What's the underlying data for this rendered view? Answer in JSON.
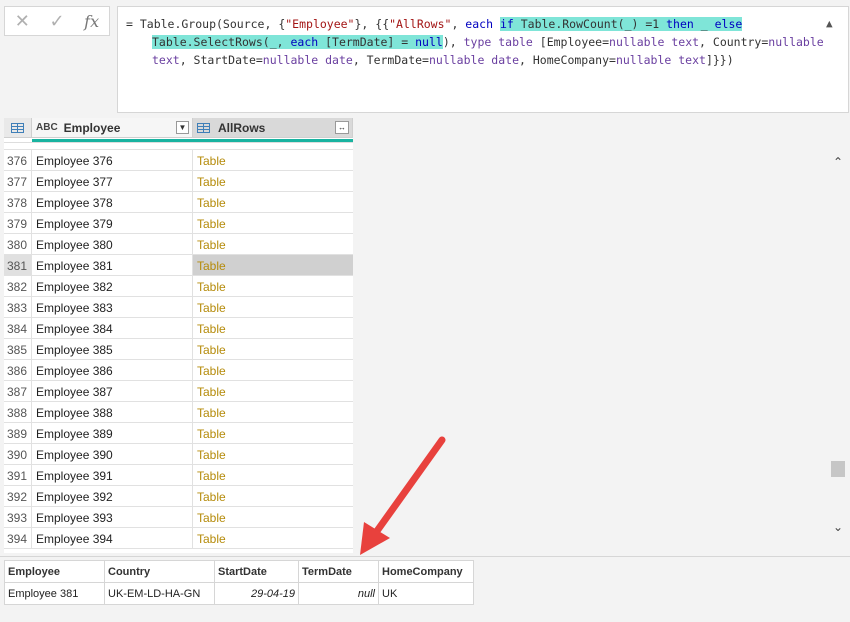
{
  "formula_bar": {
    "cancel_icon": "✕",
    "commit_icon": "✓",
    "fx_label": "fx",
    "line1": {
      "a": "= Table.Group(Source, {",
      "b": "\"Employee\"",
      "c": "}, {{",
      "d": "\"AllRows\"",
      "e": ", ",
      "f": "each",
      "g": " ",
      "h_if": "if",
      "h_rest1": " Table.RowCount(_) =1 ",
      "h_then": "then",
      "h_rest2": " _ ",
      "h_else": "else"
    },
    "line2": {
      "a": "Table.SelectRows(_, ",
      "b": "each",
      "c": " [TermDate] = ",
      "d": "null",
      "e": "), ",
      "f": "type table",
      "g": " [Employee=",
      "h": "nullable text",
      "i": ", Country=",
      "j": "nullable"
    },
    "line3": {
      "a": "text",
      "b": ", StartDate=",
      "c": "nullable date",
      "d": ", TermDate=",
      "e": "nullable date",
      "f": ", HomeCompany=",
      "g": "nullable text",
      "h": "]}})"
    }
  },
  "grid": {
    "columns": [
      {
        "name": "Employee",
        "type_icon": "ABC"
      },
      {
        "name": "AllRows",
        "type_icon": "table-icon"
      }
    ],
    "rows": [
      {
        "n": "376",
        "employee": "Employee 376",
        "value": "Table"
      },
      {
        "n": "377",
        "employee": "Employee 377",
        "value": "Table"
      },
      {
        "n": "378",
        "employee": "Employee 378",
        "value": "Table"
      },
      {
        "n": "379",
        "employee": "Employee 379",
        "value": "Table"
      },
      {
        "n": "380",
        "employee": "Employee 380",
        "value": "Table"
      },
      {
        "n": "381",
        "employee": "Employee 381",
        "value": "Table"
      },
      {
        "n": "382",
        "employee": "Employee 382",
        "value": "Table"
      },
      {
        "n": "383",
        "employee": "Employee 383",
        "value": "Table"
      },
      {
        "n": "384",
        "employee": "Employee 384",
        "value": "Table"
      },
      {
        "n": "385",
        "employee": "Employee 385",
        "value": "Table"
      },
      {
        "n": "386",
        "employee": "Employee 386",
        "value": "Table"
      },
      {
        "n": "387",
        "employee": "Employee 387",
        "value": "Table"
      },
      {
        "n": "388",
        "employee": "Employee 388",
        "value": "Table"
      },
      {
        "n": "389",
        "employee": "Employee 389",
        "value": "Table"
      },
      {
        "n": "390",
        "employee": "Employee 390",
        "value": "Table"
      },
      {
        "n": "391",
        "employee": "Employee 391",
        "value": "Table"
      },
      {
        "n": "392",
        "employee": "Employee 392",
        "value": "Table"
      },
      {
        "n": "393",
        "employee": "Employee 393",
        "value": "Table"
      },
      {
        "n": "394",
        "employee": "Employee 394",
        "value": "Table"
      }
    ],
    "selected_row": "381"
  },
  "preview": {
    "headers": [
      "Employee",
      "Country",
      "StartDate",
      "TermDate",
      "HomeCompany"
    ],
    "row": [
      "Employee 381",
      "UK-EM-LD-HA-GN",
      "29-04-19",
      "null",
      "UK"
    ]
  },
  "colors": {
    "highlight": "#7fe5d8",
    "table_link": "#b58b0a",
    "quality_bar": "#19b3a0",
    "arrow": "#e8413d"
  }
}
